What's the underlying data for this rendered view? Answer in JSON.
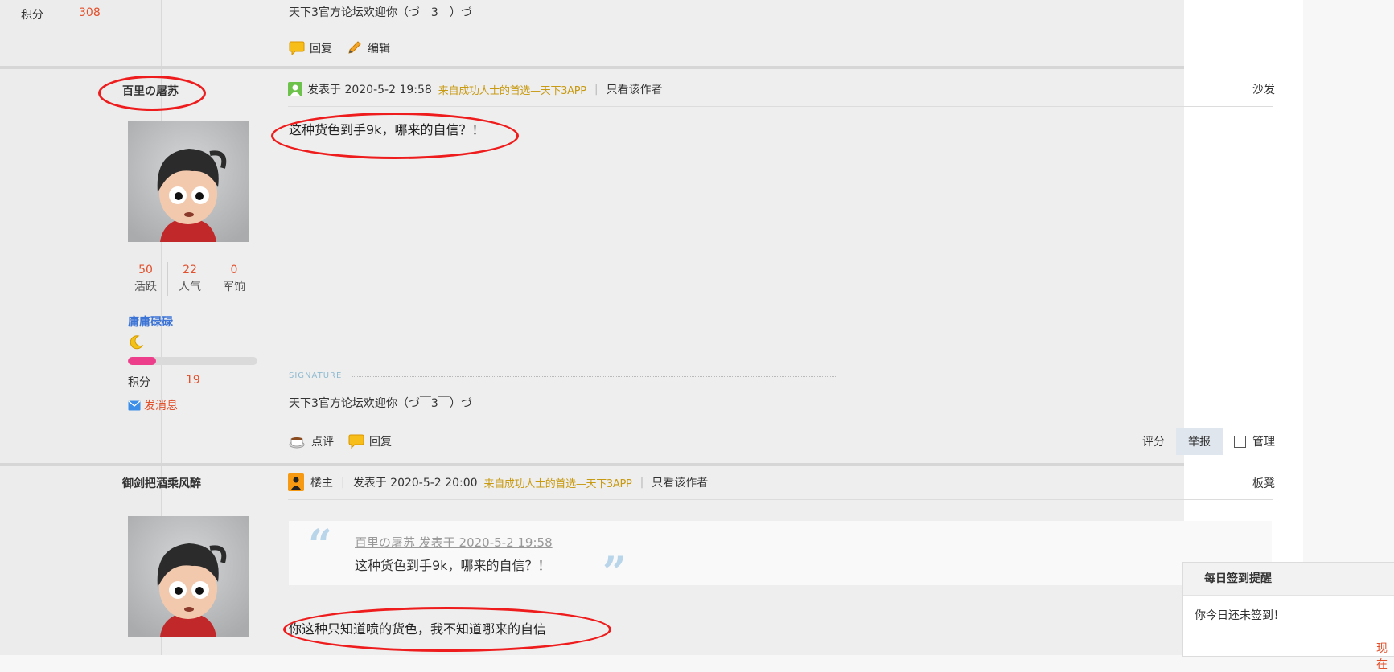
{
  "prev_post": {
    "score_label": "积分",
    "score_value": "308",
    "signature_text": "天下3官方论坛欢迎你（づ￣3￣）づ",
    "actions": {
      "reply": "回复",
      "edit": "编辑"
    }
  },
  "posts": [
    {
      "author": {
        "name": "百里の屠苏",
        "stats": [
          {
            "value": "50",
            "label": "活跃"
          },
          {
            "value": "22",
            "label": "人气"
          },
          {
            "value": "0",
            "label": "军饷"
          }
        ],
        "group": "庸庸碌碌",
        "level_progress": 0.22,
        "score_label": "积分",
        "score_value": "19",
        "send_message": "发消息"
      },
      "meta": {
        "posted": "发表于 2020-5-2 19:58",
        "app_tag": "来自成功人士的首选—天下3APP",
        "only_author": "只看该作者",
        "floor": "沙发"
      },
      "body": "这种货色到手9k，哪来的自信？！",
      "signature_label": "SIGNATURE",
      "signature_text": "天下3官方论坛欢迎你（づ￣3￣）づ",
      "actions": {
        "comment": "点评",
        "reply": "回复"
      },
      "right_actions": {
        "rate": "评分",
        "report": "举报",
        "manage": "管理"
      }
    },
    {
      "author": {
        "name": "御剑把酒乘风醉"
      },
      "meta": {
        "op_badge": "楼主",
        "posted": "发表于 2020-5-2 20:00",
        "app_tag": "来自成功人士的首选—天下3APP",
        "only_author": "只看该作者",
        "floor": "板凳"
      },
      "quote": {
        "author_line": "百里の屠苏 发表于 2020-5-2 19:58",
        "text": "这种货色到手9k，哪来的自信？！"
      },
      "body": "你这种只知道喷的货色，我不知道哪来的自信"
    }
  ],
  "sign_popup": {
    "title": "每日签到提醒",
    "message": "你今日还未签到！",
    "link": "现在"
  },
  "colors": {
    "accent_red": "#e2502c",
    "link_blue": "#3c74d6",
    "annotation_red": "#ee1c1c"
  }
}
